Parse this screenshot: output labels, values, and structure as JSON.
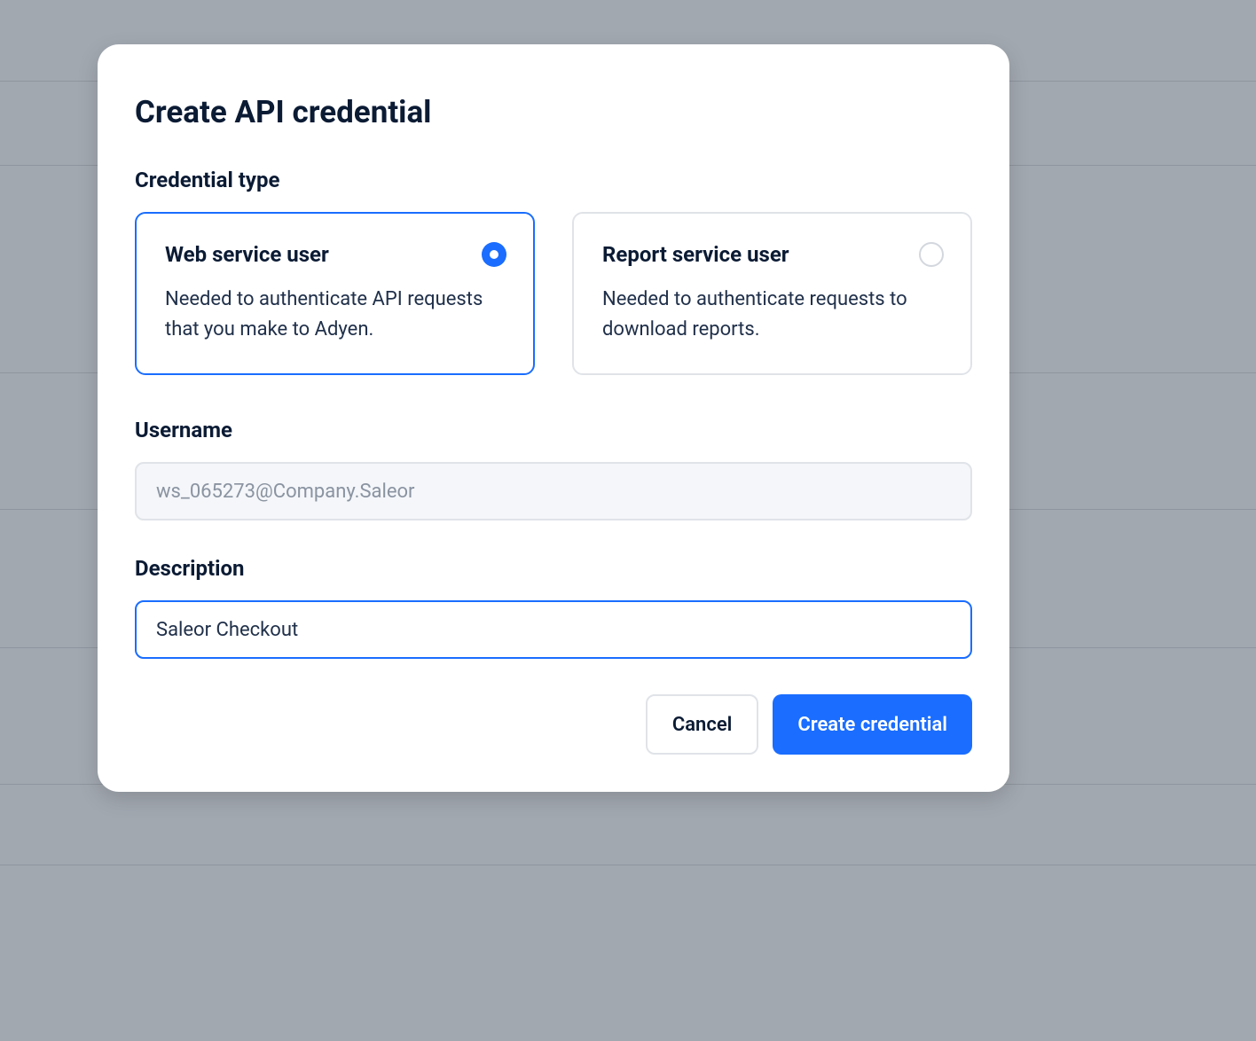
{
  "modal": {
    "title": "Create API credential",
    "credential_type_label": "Credential type",
    "options": {
      "web_service": {
        "title": "Web service user",
        "description": "Needed to authenticate API requests that you make to Adyen.",
        "selected": true
      },
      "report_service": {
        "title": "Report service user",
        "description": "Needed to authenticate requests to download reports.",
        "selected": false
      }
    },
    "username": {
      "label": "Username",
      "value": "ws_065273@Company.Saleor"
    },
    "description": {
      "label": "Description",
      "value": "Saleor Checkout"
    },
    "buttons": {
      "cancel": "Cancel",
      "create": "Create credential"
    }
  },
  "colors": {
    "primary": "#1a6dff",
    "text_dark": "#0b1b34",
    "text_body": "#20304a",
    "border": "#e0e3e8",
    "bg_overlay": "#a2a8b0"
  }
}
